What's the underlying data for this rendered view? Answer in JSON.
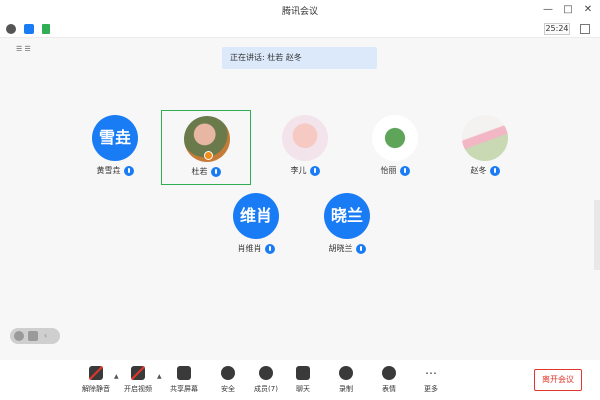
{
  "window": {
    "title": "腾讯会议"
  },
  "status": {
    "clock": "25:24"
  },
  "gallery_label": "☰ ☰",
  "share_banner": "正在讲话: 杜若 赵冬",
  "participants": [
    {
      "avatar_text": "雪垚",
      "name": "黄雪垚"
    },
    {
      "avatar_text": "",
      "name": "杜若"
    },
    {
      "avatar_text": "",
      "name": "李儿"
    },
    {
      "avatar_text": "",
      "name": "怡丽"
    },
    {
      "avatar_text": "",
      "name": "赵冬"
    },
    {
      "avatar_text": "维肖",
      "name": "肖维肖"
    },
    {
      "avatar_text": "晓兰",
      "name": "胡晓兰"
    }
  ],
  "toolbar": {
    "mute": "解除静音",
    "video": "开启视频",
    "share": "共享屏幕",
    "security": "安全",
    "members": "成员(7)",
    "chat": "聊天",
    "record": "录制",
    "reactions": "表情",
    "more": "更多",
    "leave": "离开会议"
  },
  "colors": {
    "accent": "#1a7cf5",
    "active_border": "#2fae55",
    "danger": "#e0362c"
  }
}
